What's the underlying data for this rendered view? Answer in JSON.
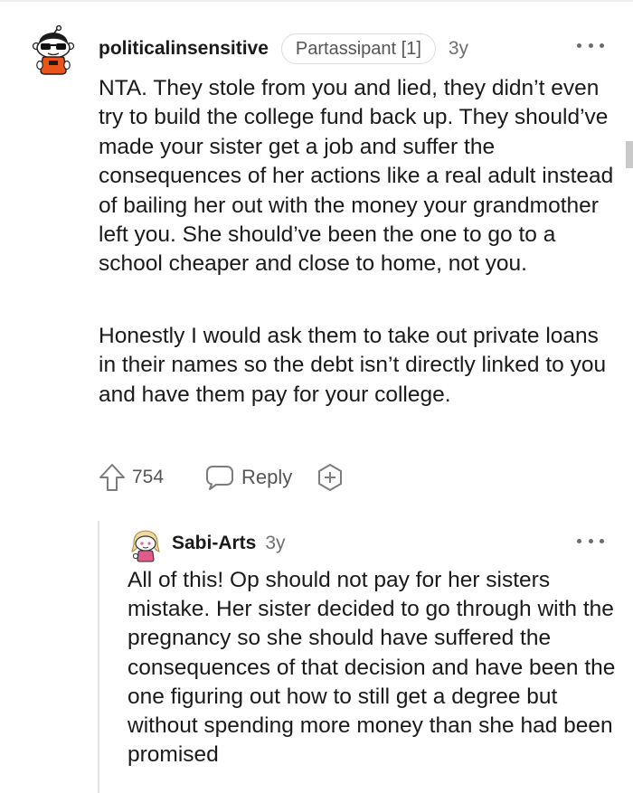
{
  "comment": {
    "username": "politicalinsensitive",
    "flair": "Partassipant [1]",
    "age": "3y",
    "paragraphs": [
      "NTA. They stole from you and lied, they didn’t even try to build the college fund back up. They should’ve made your sister get a job and suffer the consequences of her actions like a real adult instead of bailing her out with the money your grandmother left you. She should’ve been the one to go to a school cheaper and close to home, not you.",
      "Honestly I would ask them to take out private loans in their names so the debt isn’t directly linked to you and have them pay for your college."
    ],
    "score": "754",
    "reply_label": "Reply",
    "icons": {
      "avatar": "snoo-avatar-sunglasses",
      "more": "more-options-icon",
      "upvote": "upvote-arrow-icon",
      "reply": "speech-bubble-icon",
      "award": "add-award-icon"
    }
  },
  "reply": {
    "username": "Sabi-Arts",
    "age": "3y",
    "body": "All of this! Op should not pay for her sisters mistake. Her sister decided to go through with the pregnancy so she should have suffered the consequences of that decision and have been the one figuring out how to still get a degree but without spending more money than she had been promised",
    "icons": {
      "avatar": "snoo-avatar-pink-hair",
      "more": "more-options-icon"
    }
  },
  "colors": {
    "text": "#1a1a1b",
    "meta": "#6f6f6f",
    "snoo_orange": "#e8541c",
    "reply_avatar_pink": "#e25a8a"
  }
}
